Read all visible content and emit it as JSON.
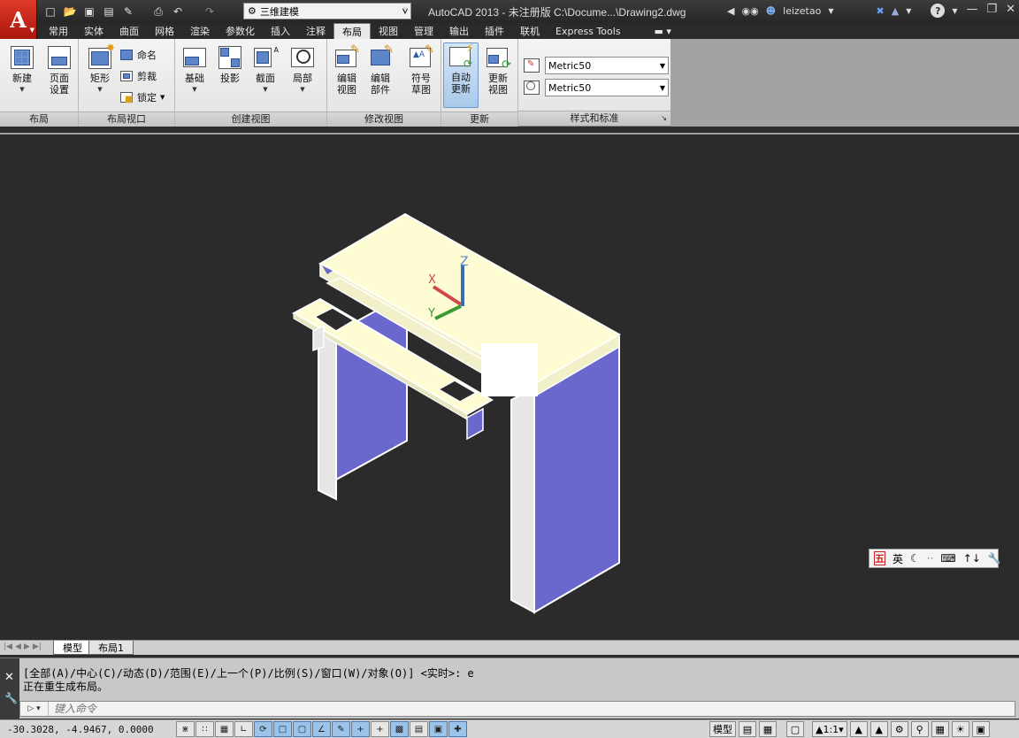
{
  "app": {
    "title": "AutoCAD 2013 - 未注册版    C:\\Docume...\\Drawing2.dwg",
    "app_letter": "A",
    "workspace": "三维建模",
    "user": "leizetao"
  },
  "quick_access": [
    "new-icon",
    "open-icon",
    "save-icon",
    "save-as-icon",
    "publish-icon",
    "print-icon",
    "undo-icon",
    "redo-icon"
  ],
  "tabs": [
    "常用",
    "实体",
    "曲面",
    "网格",
    "渲染",
    "参数化",
    "插入",
    "注释",
    "布局",
    "视图",
    "管理",
    "输出",
    "插件",
    "联机",
    "Express Tools"
  ],
  "active_tab": "布局",
  "ribbon": {
    "layout_panel": {
      "title": "布局",
      "new_label": "新建",
      "page_setup_label": "页面\n设置"
    },
    "viewport_panel": {
      "title": "布局视口",
      "rect_label": "矩形",
      "named_label": "命名",
      "clip_label": "剪裁",
      "lock_label": "锁定"
    },
    "create_view_panel": {
      "title": "创建视图",
      "base_label": "基础",
      "projected_label": "投影",
      "section_label": "截面",
      "detail_label": "局部"
    },
    "modify_view_panel": {
      "title": "修改视图",
      "edit_view_label": "编辑\n视图",
      "edit_component_label": "编辑\n部件",
      "symbol_sketch_label": "符号\n草图"
    },
    "update_panel": {
      "title": "更新",
      "auto_update_label": "自动\n更新",
      "update_view_label": "更新\n视图"
    },
    "styles_panel": {
      "title": "样式和标准",
      "style1": "Metric50",
      "style2": "Metric50"
    }
  },
  "ucs": {
    "x": "X",
    "y": "Y",
    "z": "Z"
  },
  "ime": {
    "logo": "五",
    "mode": "英"
  },
  "layout_tabs": {
    "model": "模型",
    "layout1": "布局1"
  },
  "command": {
    "history_line1": "[全部(A)/中心(C)/动态(D)/范围(E)/上一个(P)/比例(S)/窗口(W)/对象(O)] <实时>: e",
    "history_line2": "正在重生成布局。",
    "placeholder": "键入命令"
  },
  "status": {
    "coords": "-30.3028, -4.9467, 0.0000",
    "model_label": "模型",
    "scale": "1:1"
  }
}
